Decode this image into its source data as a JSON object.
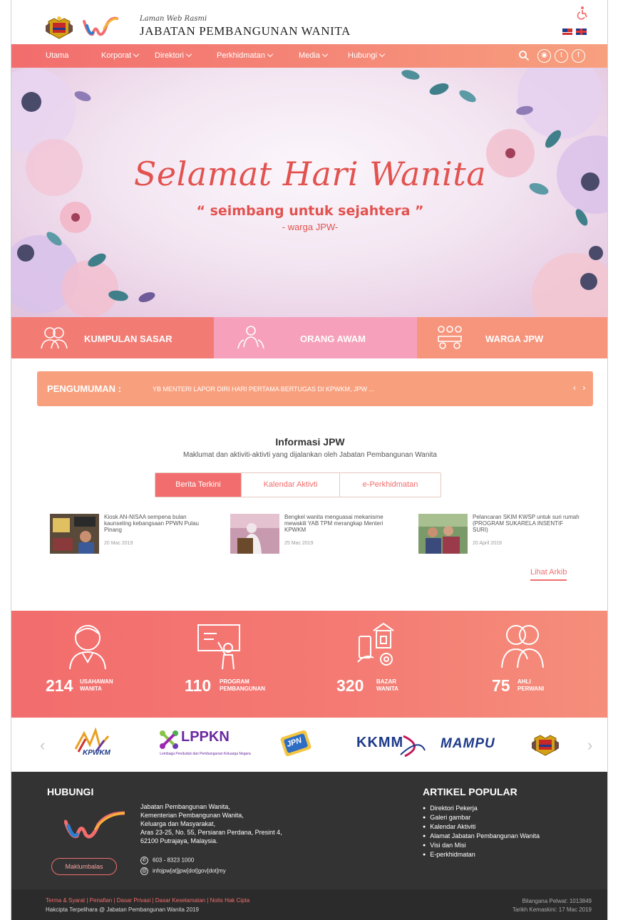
{
  "header": {
    "subtitle": "Laman Web Rasmi",
    "title": "JABATAN PEMBANGUNAN WANITA"
  },
  "nav": {
    "items": [
      {
        "label": "Utama"
      },
      {
        "label": "Korporat"
      },
      {
        "label": "Direktori"
      },
      {
        "label": "Perkhidmatan"
      },
      {
        "label": "Media"
      },
      {
        "label": "Hubungi"
      }
    ],
    "social": [
      "rss-icon",
      "twitter-icon",
      "facebook-icon"
    ]
  },
  "banner": {
    "title": "Selamat Hari Wanita",
    "quote": "“ seimbang untuk sejahtera ”",
    "signature": "- warga JPW-"
  },
  "categories": [
    {
      "label": "KUMPULAN SASAR",
      "color": "#f27c74"
    },
    {
      "label": "ORANG AWAM",
      "color": "#f6a0bc"
    },
    {
      "label": "WARGA JPW",
      "color": "#f7957c"
    }
  ],
  "announcement": {
    "label": "PENGUMUMAN :",
    "text": "YB MENTERI LAPOR DIRI HARI PERTAMA BERTUGAS DI KPWKM, JPW ...",
    "arrows": "‹ ›"
  },
  "info": {
    "title": "Informasi JPW",
    "subtitle": "Maklumat dan aktiviti-aktivti yang dijalankan oleh Jabatan Pembangunan Wanita",
    "tabs": [
      {
        "label": "Berita Terkini"
      },
      {
        "label": "Kalendar Aktivti"
      },
      {
        "label": "e-Perkhidmatan"
      }
    ],
    "news": [
      {
        "title": "Kiosk AN-NISAA sempena bulan kaunseling kebangsaan PPWN Pulau Pinang",
        "date": "20 Mac 2019"
      },
      {
        "title": "Bengkel wanita menguasai mekanisme mewakili YAB TPM merangkap Menteri KPWKM",
        "date": "25 Mac 2019"
      },
      {
        "title": "Pelancaran SKIM KWSP untuk suri rumah (PROGRAM SUKARELA INSENTIF SURI)",
        "date": "20 April 2019"
      }
    ],
    "archive_label": "Lihat Arkib"
  },
  "stats": [
    {
      "number": "214",
      "label_1": "USAHAWAN",
      "label_2": "WANITA"
    },
    {
      "number": "110",
      "label_1": "PROGRAM",
      "label_2": "PEMBANGUNAN"
    },
    {
      "number": "320",
      "label_1": "BAZAR",
      "label_2": "WANITA"
    },
    {
      "number": "75",
      "label_1": "AHLI",
      "label_2": "PERWANI"
    }
  ],
  "partners": [
    {
      "name": "KPWKM"
    },
    {
      "name": "LPPKN",
      "caption": "Lembaga Penduduk dan Pembangunan Keluarga Negara"
    },
    {
      "name": "JPN"
    },
    {
      "name": "KKMM"
    },
    {
      "name": "MAMPU"
    }
  ],
  "footer": {
    "contact_heading": "HUBUNGI",
    "address": [
      "Jabatan Pembangunan Wanita,",
      "Kementerian Pembangunan Wanita,",
      "Keluarga dan Masyarakat,",
      "Aras 23-25, No. 55, Persiaran Perdana, Presint 4,",
      "62100 Putrajaya, Malaysia."
    ],
    "phone": "603 - 8323 1000",
    "email": "infojpw[at]jpw[dot]gov[dot]my",
    "feedback_label": "Maklumbalas",
    "articles_heading": "ARTIKEL POPULAR",
    "articles": [
      "Direktori Pekerja",
      "Galeri gambar",
      "Kalendar Aktiviti",
      "Alamat Jabatan Pembangunan Wanita",
      "Visi dan Misi",
      "E-perkhidmatan"
    ]
  },
  "bottom": {
    "links": "Terma & Syarat | Penafian | Dasar Privasi | Dasar Keselamatan | Notis Hak Cipta",
    "copyright": "Hakcipta Terpelihara @ Jabatan Pembangunan Wanita 2019",
    "visitors": "Bilangana Pelwat: 1013849",
    "updated": "Tarikh Kemaskini: 17 Mac 2019"
  },
  "colors": {
    "accent": "#f26d6d",
    "peach": "#f8a07e",
    "pink": "#f6a0bc",
    "footer": "#333333"
  }
}
